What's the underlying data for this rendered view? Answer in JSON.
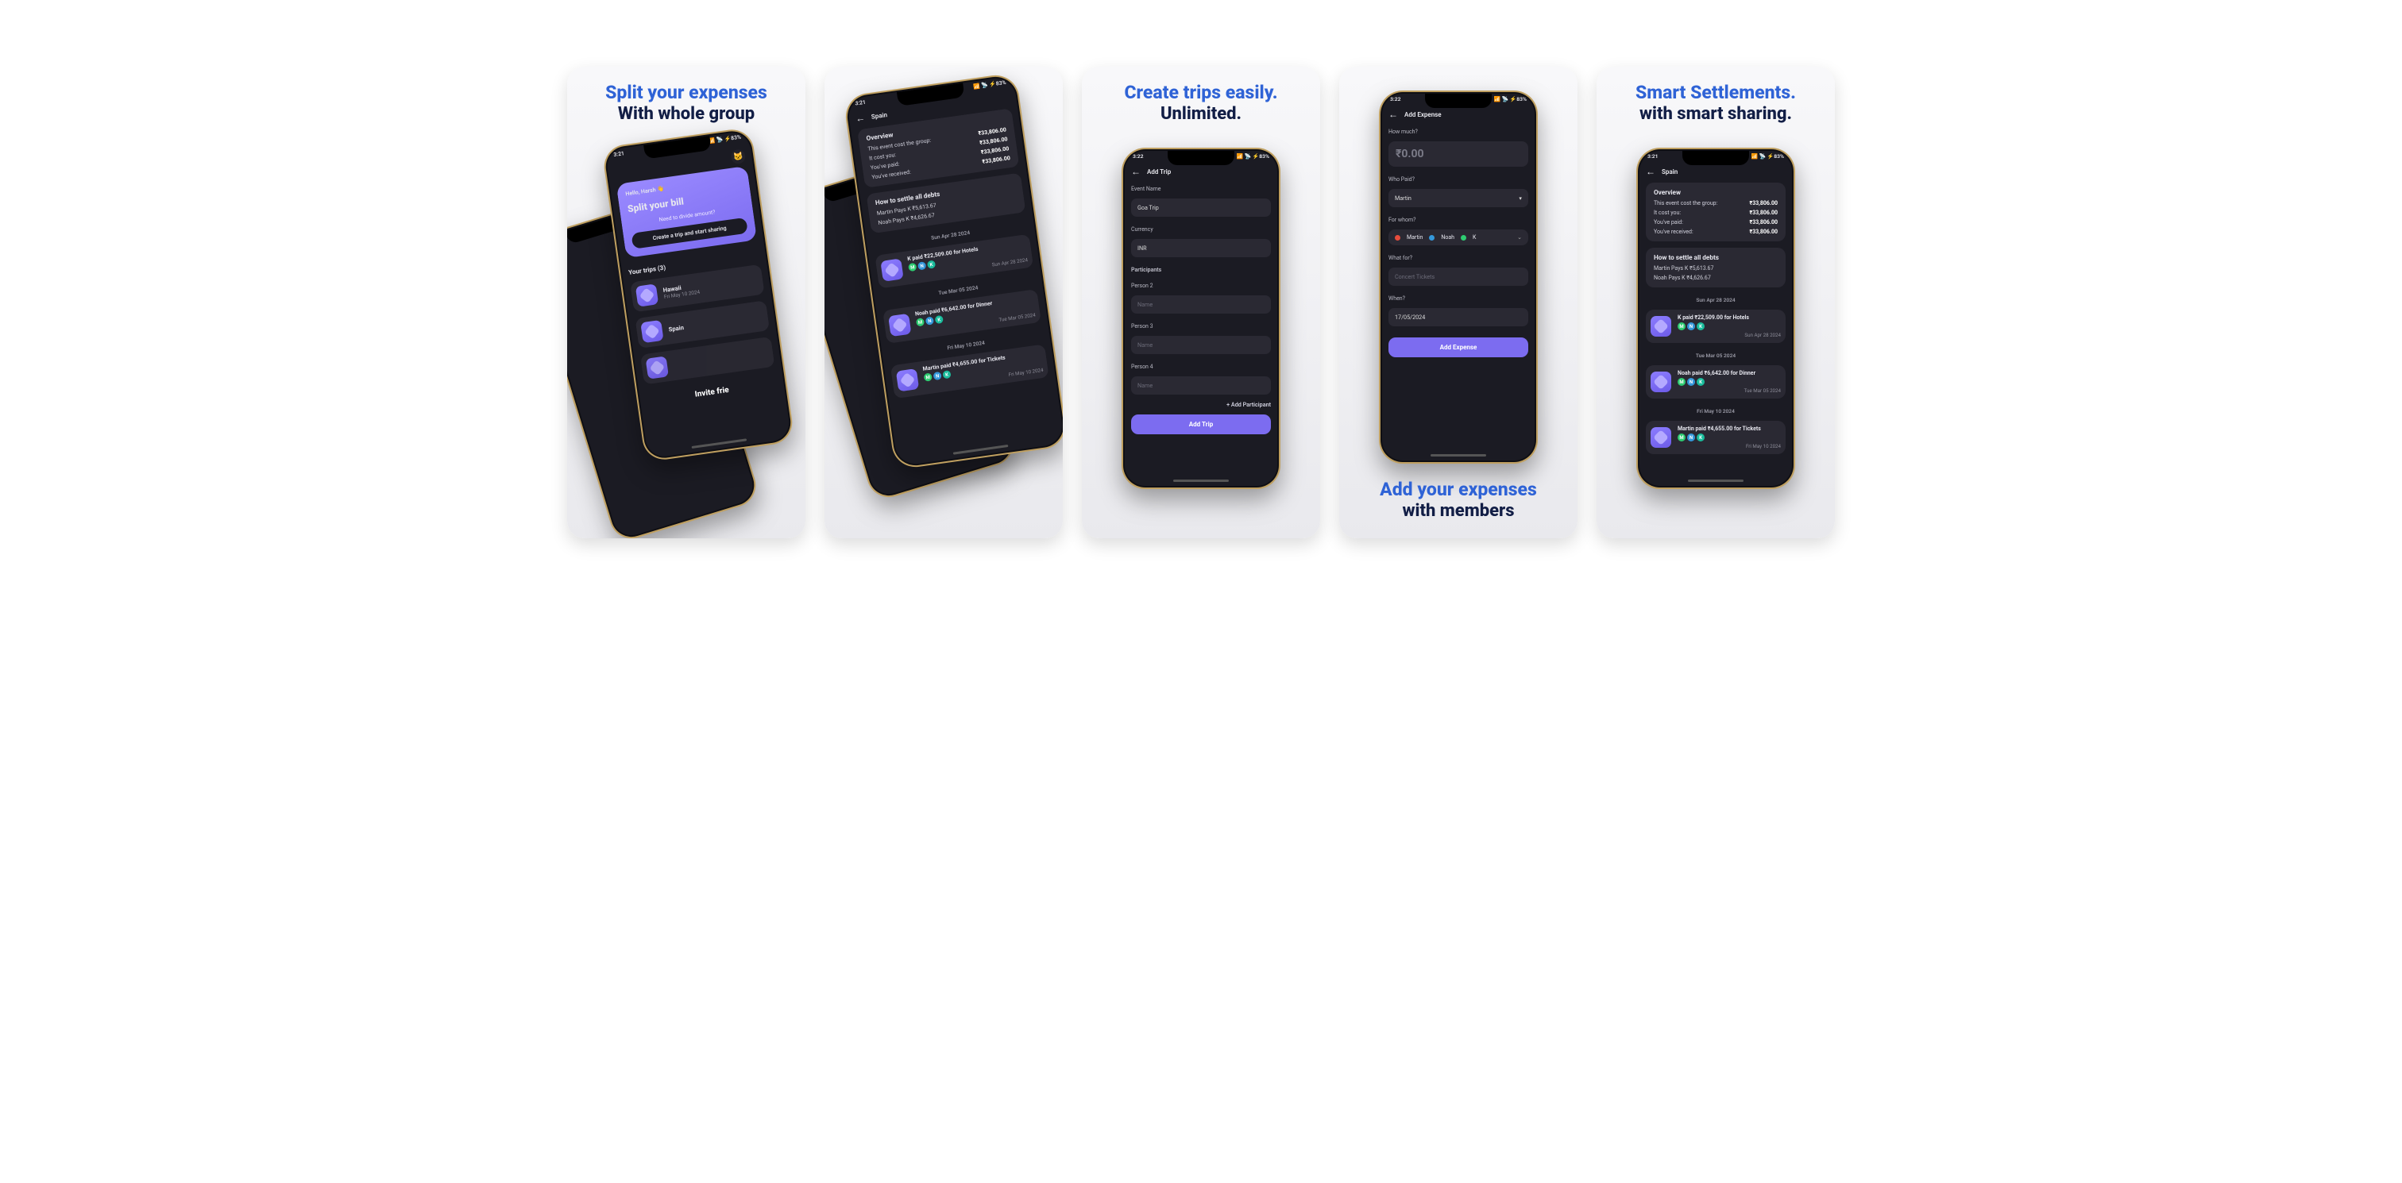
{
  "status": {
    "time1": "3:21",
    "time2": "3:22",
    "right": "📶 📡 ⚡83%"
  },
  "card1": {
    "mkt_title": "Split your expenses",
    "mkt_sub": "With whole group",
    "home": {
      "greeting": "Hello, Harsh 👋",
      "headline": "Split your bill",
      "ask": "Need to divide amount?",
      "cta": "Create a trip and start sharing",
      "trips_header": "Your trips (3)",
      "trips": [
        {
          "name": "Hawaii",
          "date": "Fri May 10 2024"
        },
        {
          "name": "Spain",
          "date": ""
        }
      ],
      "invite_teaser": "Invite frie"
    }
  },
  "common_trip": {
    "title": "Spain",
    "overview_header": "Overview",
    "lines": [
      {
        "k": "This event cost the group:",
        "v": "₹33,806.00"
      },
      {
        "k": "It cost you:",
        "v": "₹33,806.00"
      },
      {
        "k": "You've paid:",
        "v": "₹33,806.00"
      },
      {
        "k": "You've received:",
        "v": "₹33,806.00"
      }
    ],
    "settle_header": "How to settle all debts",
    "settle_lines": [
      "Martin Pays K ₹5,613.67",
      "Noah Pays K ₹4,626.67"
    ],
    "expenses": [
      {
        "date_head": "Sun Apr 28 2024",
        "title": "K paid ₹22,509.00 for Hotels",
        "sub_date": "Sun Apr 28 2024"
      },
      {
        "date_head": "Tue Mar 05 2024",
        "title": "Noah paid ₹6,642.00 for Dinner",
        "sub_date": "Tue Mar 05 2024"
      },
      {
        "date_head": "Fri May 10 2024",
        "title": "Martin paid ₹4,655.00 for Tickets",
        "sub_date": "Fri May 10 2024"
      }
    ]
  },
  "card3": {
    "mkt_title": "Create trips easily.",
    "mkt_sub": "Unlimited.",
    "title": "Add Trip",
    "labels": {
      "event_name": "Event Name",
      "currency": "Currency",
      "participants": "Participants",
      "person2": "Person 2",
      "person3": "Person 3",
      "person4": "Person 4",
      "name_ph": "Name",
      "add_participant": "+ Add Participant",
      "add_trip_btn": "Add Trip"
    },
    "values": {
      "event_name": "Goa Trip",
      "currency": "INR"
    }
  },
  "card4": {
    "mkt_title": "Add your expenses",
    "mkt_sub": "with members",
    "title": "Add Expense",
    "labels": {
      "how_much": "How much?",
      "who_paid": "Who Paid?",
      "for_whom": "For whom?",
      "what_for": "What for?",
      "when": "When?",
      "add_expense_btn": "Add Expense"
    },
    "values": {
      "amount": "₹0.00",
      "payer": "Martin",
      "chips": [
        "Martin",
        "Noah",
        "K"
      ],
      "what_for_ph": "Concert Tickets",
      "when": "17/05/2024"
    }
  },
  "card5": {
    "mkt_title": "Smart Settlements.",
    "mkt_sub": "with smart sharing."
  }
}
